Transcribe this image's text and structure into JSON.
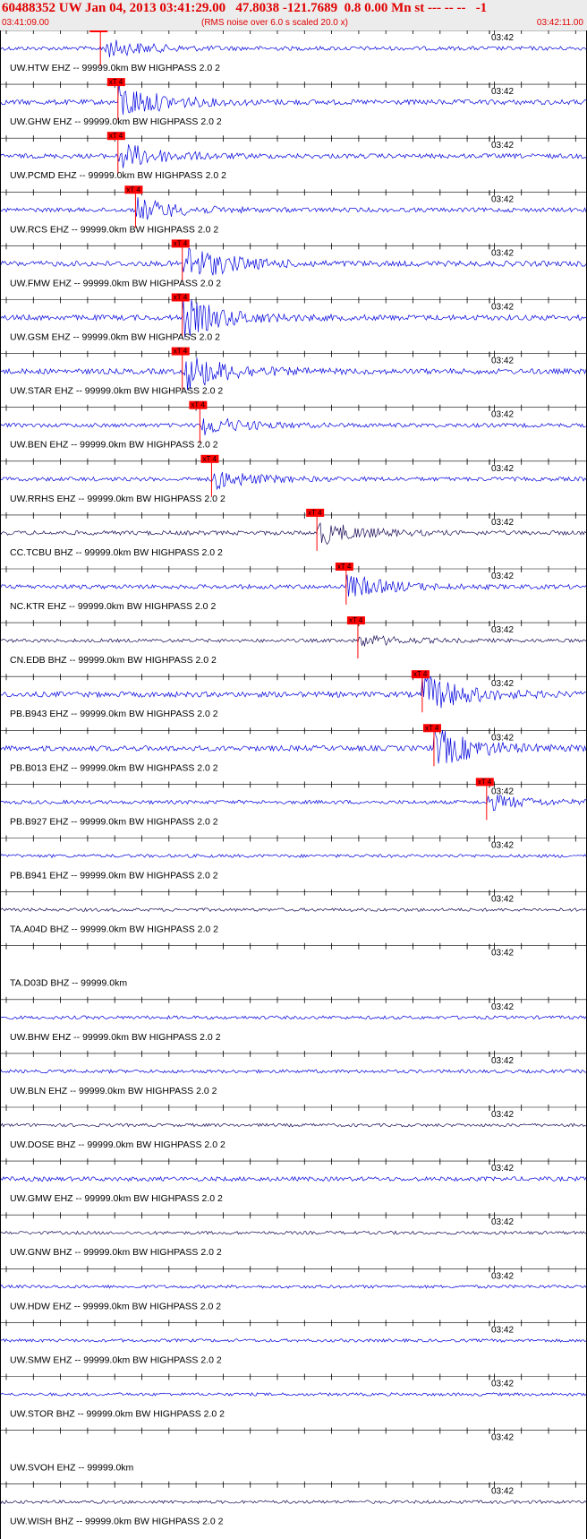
{
  "header": {
    "title": "60488352 UW Jan 04, 2013 03:41:29.00   47.8038 -121.7689  0.8 0.00 Mn st --- -- --   -1",
    "start_time": "03:41:09.00",
    "note": "(RMS noise over 6.0 s scaled 20.0 x)",
    "end_time": "03:42:11.00"
  },
  "minute_label": "03:42",
  "pick_label": "xT 4",
  "colors": {
    "header_text": "#e00000",
    "trace_blue": "#0000dd",
    "trace_dark": "#1a0a55",
    "pick_box": "#ff0000",
    "grid": "#000000"
  },
  "traces": [
    {
      "label": "UW.HTW EHZ -- 99999.0km BW  HIGHPASS  2.0  2",
      "color": "blue",
      "pick": 0.17,
      "amp": 0.5
    },
    {
      "label": "UW.GHW EHZ -- 99999.0km BW  HIGHPASS  2.0  2",
      "color": "blue",
      "pick": 0.2,
      "amp": 0.9
    },
    {
      "label": "UW.PCMD EHZ -- 99999.0km BW  HIGHPASS  2.0  2",
      "color": "blue",
      "pick": 0.2,
      "amp": 0.7
    },
    {
      "label": "UW.RCS EHZ -- 99999.0km BW  HIGHPASS  2.0  2",
      "color": "blue",
      "pick": 0.23,
      "amp": 0.6
    },
    {
      "label": "UW.FMW EHZ -- 99999.0km BW  HIGHPASS  2.0  2",
      "color": "blue",
      "pick": 0.31,
      "amp": 1.0
    },
    {
      "label": "UW.GSM EHZ -- 99999.0km BW  HIGHPASS  2.0  2",
      "color": "blue",
      "pick": 0.31,
      "amp": 1.0
    },
    {
      "label": "UW.STAR EHZ -- 99999.0km BW  HIGHPASS  2.0  2",
      "color": "blue",
      "pick": 0.31,
      "amp": 1.0
    },
    {
      "label": "UW.BEN EHZ -- 99999.0km BW  HIGHPASS  2.0  2",
      "color": "blue",
      "pick": 0.34,
      "amp": 0.5
    },
    {
      "label": "UW.RRHS EHZ -- 99999.0km BW  HIGHPASS  2.0  2",
      "color": "blue",
      "pick": 0.36,
      "amp": 0.5
    },
    {
      "label": "CC.TCBU BHZ -- 99999.0km BW  HIGHPASS  2.0  2",
      "color": "dark",
      "pick": 0.54,
      "amp": 0.6
    },
    {
      "label": "NC.KTR EHZ -- 99999.0km BW  HIGHPASS  2.0  2",
      "color": "blue",
      "pick": 0.59,
      "amp": 0.6
    },
    {
      "label": "CN.EDB BHZ -- 99999.0km BW  HIGHPASS  2.0  2",
      "color": "dark",
      "pick": 0.61,
      "amp": 0.3
    },
    {
      "label": "PB.B943 EHZ -- 99999.0km BW  HIGHPASS  2.0  2",
      "color": "blue",
      "pick": 0.72,
      "amp": 1.0
    },
    {
      "label": "PB.B013 EHZ -- 99999.0km BW  HIGHPASS  2.0  2",
      "color": "blue",
      "pick": 0.74,
      "amp": 1.0
    },
    {
      "label": "PB.B927 EHZ -- 99999.0km BW  HIGHPASS  2.0  2",
      "color": "blue",
      "pick": 0.83,
      "amp": 0.4
    },
    {
      "label": "PB.B941 EHZ -- 99999.0km BW  HIGHPASS  2.0  2",
      "color": "blue",
      "pick": null,
      "amp": 0.2
    },
    {
      "label": "TA.A04D BHZ -- 99999.0km BW  HIGHPASS  2.0  2",
      "color": "dark",
      "pick": null,
      "amp": 0.2
    },
    {
      "label": "TA.D03D BHZ -- 99999.0km",
      "color": "none",
      "pick": null,
      "amp": 0
    },
    {
      "label": "UW.BHW EHZ -- 99999.0km BW  HIGHPASS  2.0  2",
      "color": "blue",
      "pick": null,
      "amp": 0.25
    },
    {
      "label": "UW.BLN EHZ -- 99999.0km BW  HIGHPASS  2.0  2",
      "color": "blue",
      "pick": null,
      "amp": 0.25
    },
    {
      "label": "UW.DOSE BHZ -- 99999.0km BW  HIGHPASS  2.0  2",
      "color": "dark",
      "pick": null,
      "amp": 0.2
    },
    {
      "label": "UW.GMW EHZ -- 99999.0km BW  HIGHPASS  2.0  2",
      "color": "blue",
      "pick": null,
      "amp": 0.6
    },
    {
      "label": "UW.GNW BHZ -- 99999.0km BW  HIGHPASS  2.0  2",
      "color": "dark",
      "pick": null,
      "amp": 0.2
    },
    {
      "label": "UW.HDW EHZ -- 99999.0km BW  HIGHPASS  2.0  2",
      "color": "blue",
      "pick": null,
      "amp": 0.2
    },
    {
      "label": "UW.SMW EHZ -- 99999.0km BW  HIGHPASS  2.0  2",
      "color": "blue",
      "pick": null,
      "amp": 0.15
    },
    {
      "label": "UW.STOR BHZ -- 99999.0km BW  HIGHPASS  2.0  2",
      "color": "blue",
      "pick": null,
      "amp": 0.15
    },
    {
      "label": "UW.SVOH EHZ -- 99999.0km",
      "color": "none",
      "pick": null,
      "amp": 0
    },
    {
      "label": "UW.WISH BHZ -- 99999.0km BW  HIGHPASS  2.0  2",
      "color": "dark",
      "pick": null,
      "amp": 0.2
    }
  ]
}
